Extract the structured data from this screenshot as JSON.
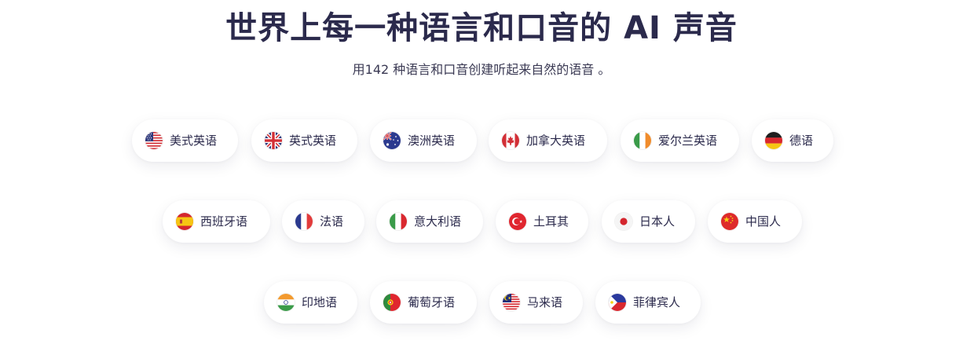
{
  "header": {
    "title": "世界上每一种语言和口音的 AI 声音",
    "subtitle": "用142 种语言和口音创建听起来自然的语音 。"
  },
  "languages": [
    {
      "label": "美式英语",
      "icon": "us-flag-icon"
    },
    {
      "label": "英式英语",
      "icon": "uk-flag-icon"
    },
    {
      "label": "澳洲英语",
      "icon": "australia-flag-icon"
    },
    {
      "label": "加拿大英语",
      "icon": "canada-flag-icon"
    },
    {
      "label": "爱尔兰英语",
      "icon": "ireland-flag-icon"
    },
    {
      "label": "德语",
      "icon": "germany-flag-icon"
    },
    {
      "label": "西班牙语",
      "icon": "spain-flag-icon"
    },
    {
      "label": "法语",
      "icon": "france-flag-icon"
    },
    {
      "label": "意大利语",
      "icon": "italy-flag-icon"
    },
    {
      "label": "土耳其",
      "icon": "turkey-flag-icon"
    },
    {
      "label": "日本人",
      "icon": "japan-flag-icon"
    },
    {
      "label": "中国人",
      "icon": "china-flag-icon"
    },
    {
      "label": "印地语",
      "icon": "india-flag-icon"
    },
    {
      "label": "葡萄牙语",
      "icon": "portugal-flag-icon"
    },
    {
      "label": "马来语",
      "icon": "malaysia-flag-icon"
    },
    {
      "label": "菲律宾人",
      "icon": "philippines-flag-icon"
    }
  ]
}
